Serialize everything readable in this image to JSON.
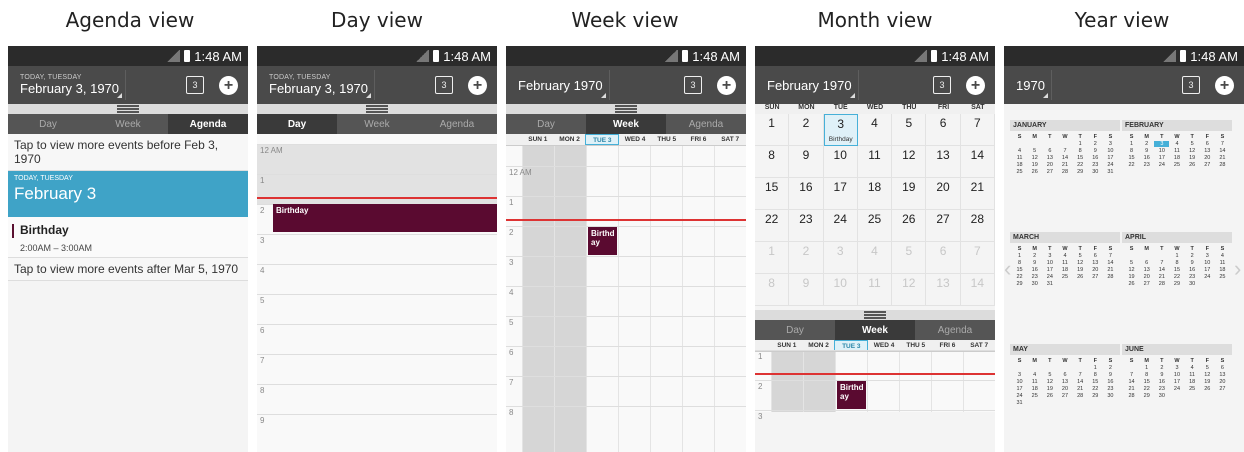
{
  "captions": [
    "Agenda view",
    "Day view",
    "Week view",
    "Month view",
    "Year view"
  ],
  "status_time": "1:48 AM",
  "actionbar": {
    "today_label": "TODAY, TUESDAY",
    "date_full": "February 3, 1970",
    "month_year": "February 1970",
    "year": "1970",
    "cal_icon_num": "3",
    "add_symbol": "+"
  },
  "tabs": [
    "Day",
    "Week",
    "Agenda"
  ],
  "agenda": {
    "tap_before": "Tap to view more events before Feb 3, 1970",
    "date_small": "TODAY, TUESDAY",
    "date_big": "February 3",
    "event_title": "Birthday",
    "event_time": "2:00AM – 3:00AM",
    "tap_after": "Tap to view more events after Mar 5, 1970"
  },
  "event_name": "Birthday",
  "event_name_week": "Birthd ay",
  "day_hours": [
    "12 AM",
    "1",
    "2",
    "3",
    "4",
    "5",
    "6",
    "7",
    "8",
    "9"
  ],
  "week_days": [
    "SUN 1",
    "MON 2",
    "TUE 3",
    "WED 4",
    "THU 5",
    "FRI 6",
    "SAT 7"
  ],
  "month": {
    "weekdays": [
      "SUN",
      "MON",
      "TUE",
      "WED",
      "THU",
      "FRI",
      "SAT"
    ],
    "rows": [
      [
        "1",
        "2",
        "3",
        "4",
        "5",
        "6",
        "7"
      ],
      [
        "8",
        "9",
        "10",
        "11",
        "12",
        "13",
        "14"
      ],
      [
        "15",
        "16",
        "17",
        "18",
        "19",
        "20",
        "21"
      ],
      [
        "22",
        "23",
        "24",
        "25",
        "26",
        "27",
        "28"
      ],
      [
        "1",
        "2",
        "3",
        "4",
        "5",
        "6",
        "7"
      ],
      [
        "8",
        "9",
        "10",
        "11",
        "12",
        "13",
        "14"
      ]
    ],
    "event_label": "Birthday"
  },
  "year_months": [
    {
      "name": "JANUARY",
      "offset": 4,
      "days": 31
    },
    {
      "name": "FEBRUARY",
      "offset": 0,
      "days": 28
    },
    {
      "name": "MARCH",
      "offset": 0,
      "days": 31
    },
    {
      "name": "APRIL",
      "offset": 3,
      "days": 30
    },
    {
      "name": "MAY",
      "offset": 5,
      "days": 31
    },
    {
      "name": "JUNE",
      "offset": 1,
      "days": 30
    }
  ],
  "year_weekdays": [
    "S",
    "M",
    "T",
    "W",
    "T",
    "F",
    "S"
  ],
  "colors": {
    "accent": "#3fa3c7",
    "event": "#5a0a30",
    "now_line": "#dd3333"
  }
}
